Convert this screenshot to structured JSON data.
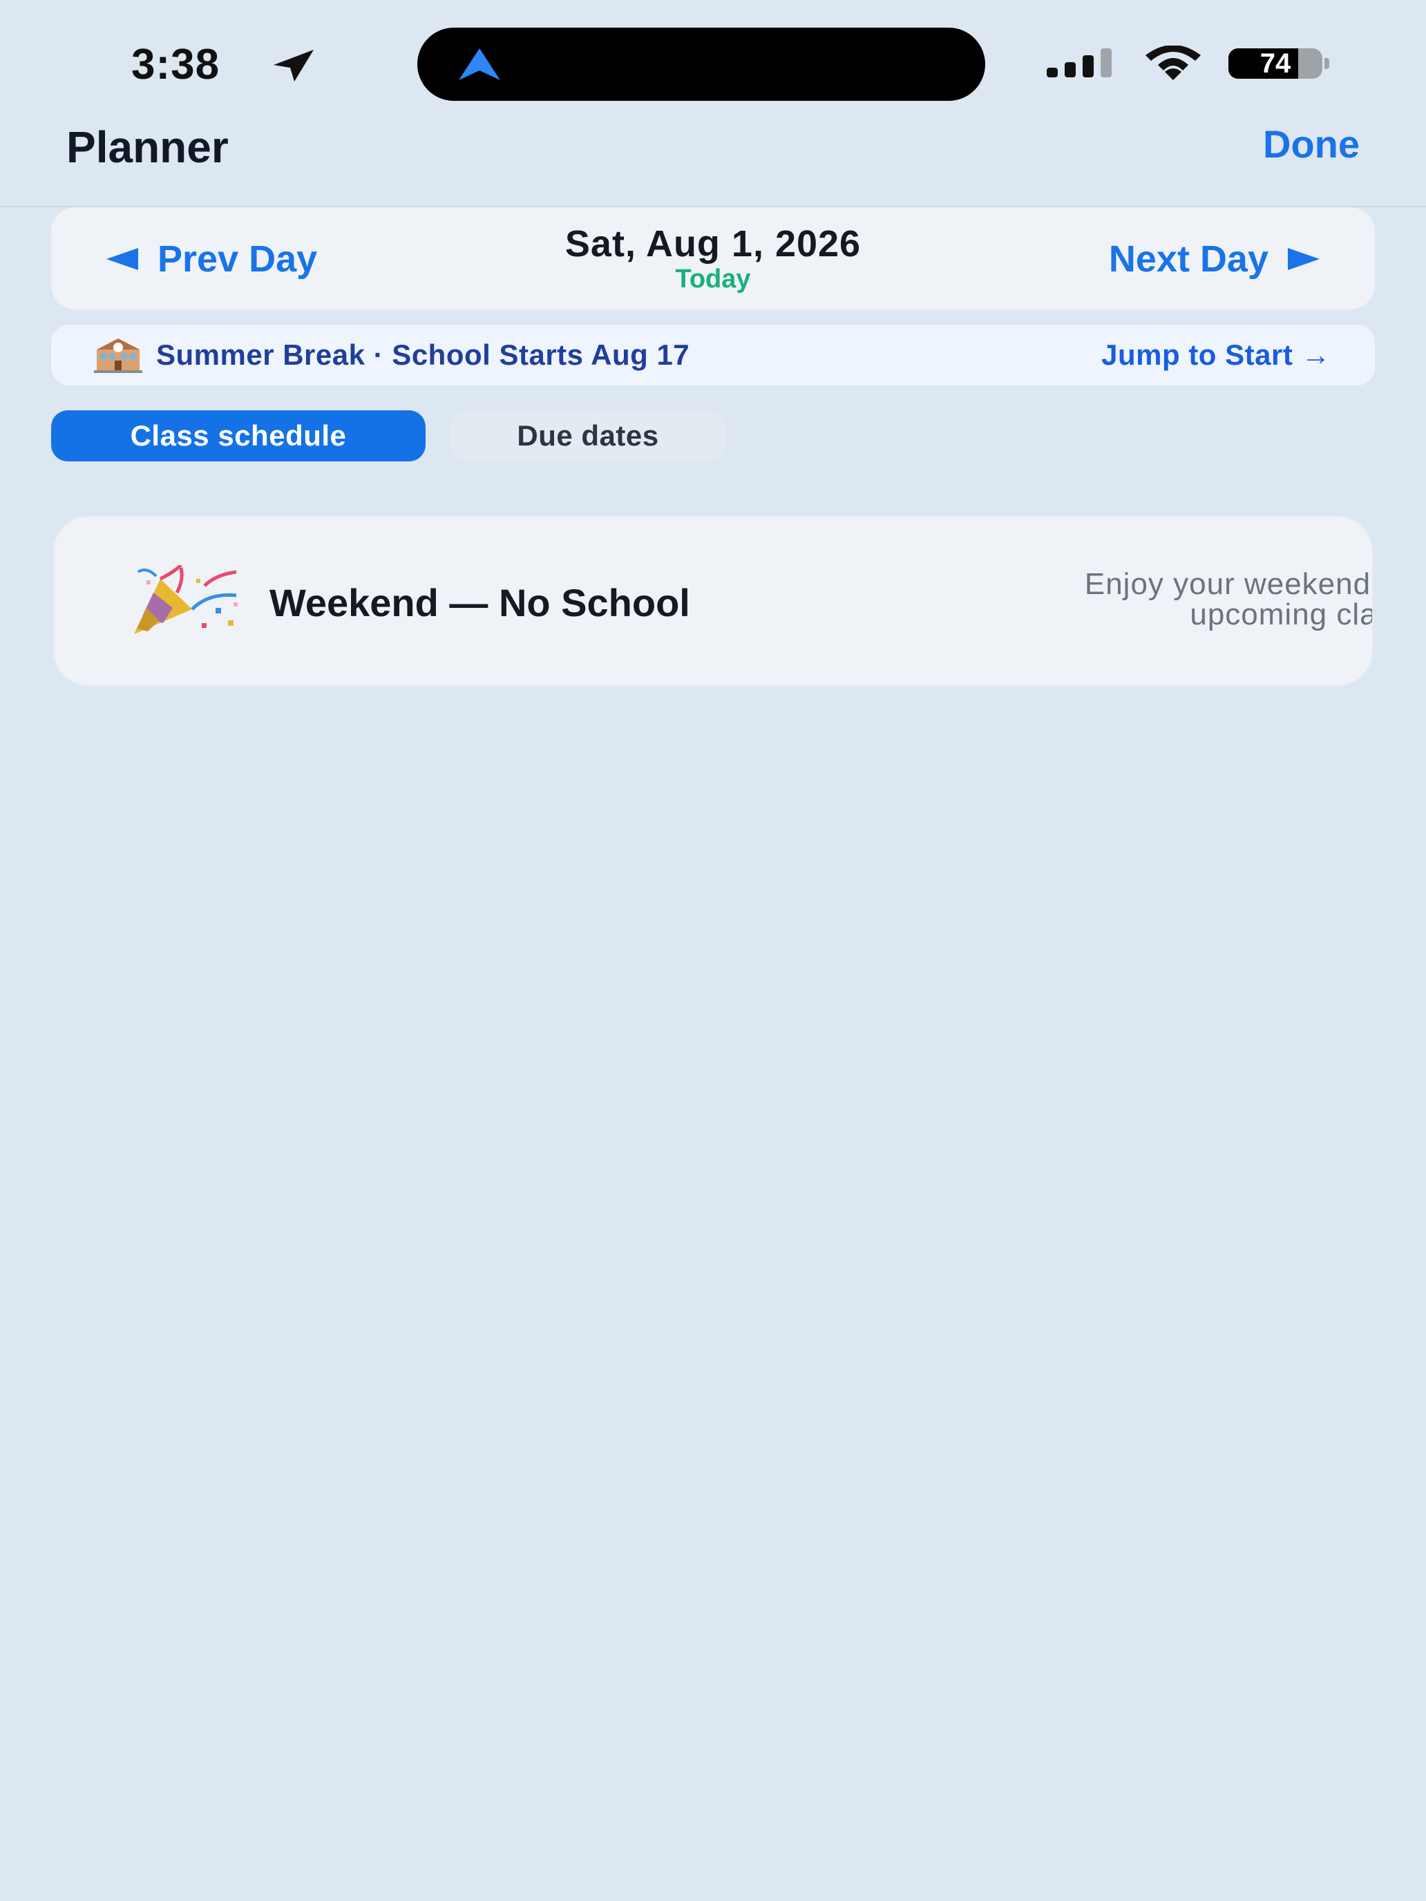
{
  "status_bar": {
    "time": "3:38",
    "battery_level": "74",
    "battery_fraction": 0.74
  },
  "header": {
    "title": "Planner",
    "done_label": "Done"
  },
  "day_nav": {
    "prev_label": "Prev Day",
    "next_label": "Next Day",
    "date": "Sat, Aug 1, 2026",
    "today_label": "Today"
  },
  "banner": {
    "text": "Summer Break · School Starts Aug 17",
    "jump_label": "Jump to Start →"
  },
  "tabs": [
    {
      "label": "Class schedule",
      "selected": true
    },
    {
      "label": "Due dates",
      "selected": false
    }
  ],
  "weekend_card": {
    "title": "Weekend — No School",
    "message_line1": "Enjoy your weekend! Switch",
    "message_line2": "upcoming cla"
  },
  "icons": {
    "location": "location-arrow-icon",
    "navigation": "navigation-arrow-icon",
    "signal": "cellular-signal-icon",
    "wifi": "wifi-icon",
    "battery": "battery-icon",
    "school": "school-building-icon",
    "party": "party-popper-icon"
  },
  "colors": {
    "background": "#dde7f1",
    "accent": "#1a73e8",
    "today": "#19b07a",
    "banner_text": "#213e9a"
  }
}
